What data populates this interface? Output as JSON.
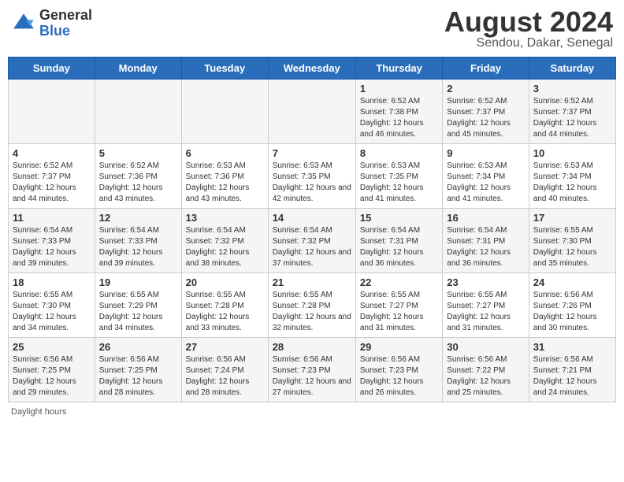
{
  "header": {
    "logo_general": "General",
    "logo_blue": "Blue",
    "month_title": "August 2024",
    "location": "Sendou, Dakar, Senegal"
  },
  "days_of_week": [
    "Sunday",
    "Monday",
    "Tuesday",
    "Wednesday",
    "Thursday",
    "Friday",
    "Saturday"
  ],
  "footer": {
    "daylight_label": "Daylight hours"
  },
  "weeks": [
    [
      {
        "day": "",
        "sunrise": "",
        "sunset": "",
        "daylight": ""
      },
      {
        "day": "",
        "sunrise": "",
        "sunset": "",
        "daylight": ""
      },
      {
        "day": "",
        "sunrise": "",
        "sunset": "",
        "daylight": ""
      },
      {
        "day": "",
        "sunrise": "",
        "sunset": "",
        "daylight": ""
      },
      {
        "day": "1",
        "sunrise": "Sunrise: 6:52 AM",
        "sunset": "Sunset: 7:38 PM",
        "daylight": "Daylight: 12 hours and 46 minutes."
      },
      {
        "day": "2",
        "sunrise": "Sunrise: 6:52 AM",
        "sunset": "Sunset: 7:37 PM",
        "daylight": "Daylight: 12 hours and 45 minutes."
      },
      {
        "day": "3",
        "sunrise": "Sunrise: 6:52 AM",
        "sunset": "Sunset: 7:37 PM",
        "daylight": "Daylight: 12 hours and 44 minutes."
      }
    ],
    [
      {
        "day": "4",
        "sunrise": "Sunrise: 6:52 AM",
        "sunset": "Sunset: 7:37 PM",
        "daylight": "Daylight: 12 hours and 44 minutes."
      },
      {
        "day": "5",
        "sunrise": "Sunrise: 6:52 AM",
        "sunset": "Sunset: 7:36 PM",
        "daylight": "Daylight: 12 hours and 43 minutes."
      },
      {
        "day": "6",
        "sunrise": "Sunrise: 6:53 AM",
        "sunset": "Sunset: 7:36 PM",
        "daylight": "Daylight: 12 hours and 43 minutes."
      },
      {
        "day": "7",
        "sunrise": "Sunrise: 6:53 AM",
        "sunset": "Sunset: 7:35 PM",
        "daylight": "Daylight: 12 hours and 42 minutes."
      },
      {
        "day": "8",
        "sunrise": "Sunrise: 6:53 AM",
        "sunset": "Sunset: 7:35 PM",
        "daylight": "Daylight: 12 hours and 41 minutes."
      },
      {
        "day": "9",
        "sunrise": "Sunrise: 6:53 AM",
        "sunset": "Sunset: 7:34 PM",
        "daylight": "Daylight: 12 hours and 41 minutes."
      },
      {
        "day": "10",
        "sunrise": "Sunrise: 6:53 AM",
        "sunset": "Sunset: 7:34 PM",
        "daylight": "Daylight: 12 hours and 40 minutes."
      }
    ],
    [
      {
        "day": "11",
        "sunrise": "Sunrise: 6:54 AM",
        "sunset": "Sunset: 7:33 PM",
        "daylight": "Daylight: 12 hours and 39 minutes."
      },
      {
        "day": "12",
        "sunrise": "Sunrise: 6:54 AM",
        "sunset": "Sunset: 7:33 PM",
        "daylight": "Daylight: 12 hours and 39 minutes."
      },
      {
        "day": "13",
        "sunrise": "Sunrise: 6:54 AM",
        "sunset": "Sunset: 7:32 PM",
        "daylight": "Daylight: 12 hours and 38 minutes."
      },
      {
        "day": "14",
        "sunrise": "Sunrise: 6:54 AM",
        "sunset": "Sunset: 7:32 PM",
        "daylight": "Daylight: 12 hours and 37 minutes."
      },
      {
        "day": "15",
        "sunrise": "Sunrise: 6:54 AM",
        "sunset": "Sunset: 7:31 PM",
        "daylight": "Daylight: 12 hours and 36 minutes."
      },
      {
        "day": "16",
        "sunrise": "Sunrise: 6:54 AM",
        "sunset": "Sunset: 7:31 PM",
        "daylight": "Daylight: 12 hours and 36 minutes."
      },
      {
        "day": "17",
        "sunrise": "Sunrise: 6:55 AM",
        "sunset": "Sunset: 7:30 PM",
        "daylight": "Daylight: 12 hours and 35 minutes."
      }
    ],
    [
      {
        "day": "18",
        "sunrise": "Sunrise: 6:55 AM",
        "sunset": "Sunset: 7:30 PM",
        "daylight": "Daylight: 12 hours and 34 minutes."
      },
      {
        "day": "19",
        "sunrise": "Sunrise: 6:55 AM",
        "sunset": "Sunset: 7:29 PM",
        "daylight": "Daylight: 12 hours and 34 minutes."
      },
      {
        "day": "20",
        "sunrise": "Sunrise: 6:55 AM",
        "sunset": "Sunset: 7:28 PM",
        "daylight": "Daylight: 12 hours and 33 minutes."
      },
      {
        "day": "21",
        "sunrise": "Sunrise: 6:55 AM",
        "sunset": "Sunset: 7:28 PM",
        "daylight": "Daylight: 12 hours and 32 minutes."
      },
      {
        "day": "22",
        "sunrise": "Sunrise: 6:55 AM",
        "sunset": "Sunset: 7:27 PM",
        "daylight": "Daylight: 12 hours and 31 minutes."
      },
      {
        "day": "23",
        "sunrise": "Sunrise: 6:55 AM",
        "sunset": "Sunset: 7:27 PM",
        "daylight": "Daylight: 12 hours and 31 minutes."
      },
      {
        "day": "24",
        "sunrise": "Sunrise: 6:56 AM",
        "sunset": "Sunset: 7:26 PM",
        "daylight": "Daylight: 12 hours and 30 minutes."
      }
    ],
    [
      {
        "day": "25",
        "sunrise": "Sunrise: 6:56 AM",
        "sunset": "Sunset: 7:25 PM",
        "daylight": "Daylight: 12 hours and 29 minutes."
      },
      {
        "day": "26",
        "sunrise": "Sunrise: 6:56 AM",
        "sunset": "Sunset: 7:25 PM",
        "daylight": "Daylight: 12 hours and 28 minutes."
      },
      {
        "day": "27",
        "sunrise": "Sunrise: 6:56 AM",
        "sunset": "Sunset: 7:24 PM",
        "daylight": "Daylight: 12 hours and 28 minutes."
      },
      {
        "day": "28",
        "sunrise": "Sunrise: 6:56 AM",
        "sunset": "Sunset: 7:23 PM",
        "daylight": "Daylight: 12 hours and 27 minutes."
      },
      {
        "day": "29",
        "sunrise": "Sunrise: 6:56 AM",
        "sunset": "Sunset: 7:23 PM",
        "daylight": "Daylight: 12 hours and 26 minutes."
      },
      {
        "day": "30",
        "sunrise": "Sunrise: 6:56 AM",
        "sunset": "Sunset: 7:22 PM",
        "daylight": "Daylight: 12 hours and 25 minutes."
      },
      {
        "day": "31",
        "sunrise": "Sunrise: 6:56 AM",
        "sunset": "Sunset: 7:21 PM",
        "daylight": "Daylight: 12 hours and 24 minutes."
      }
    ]
  ]
}
